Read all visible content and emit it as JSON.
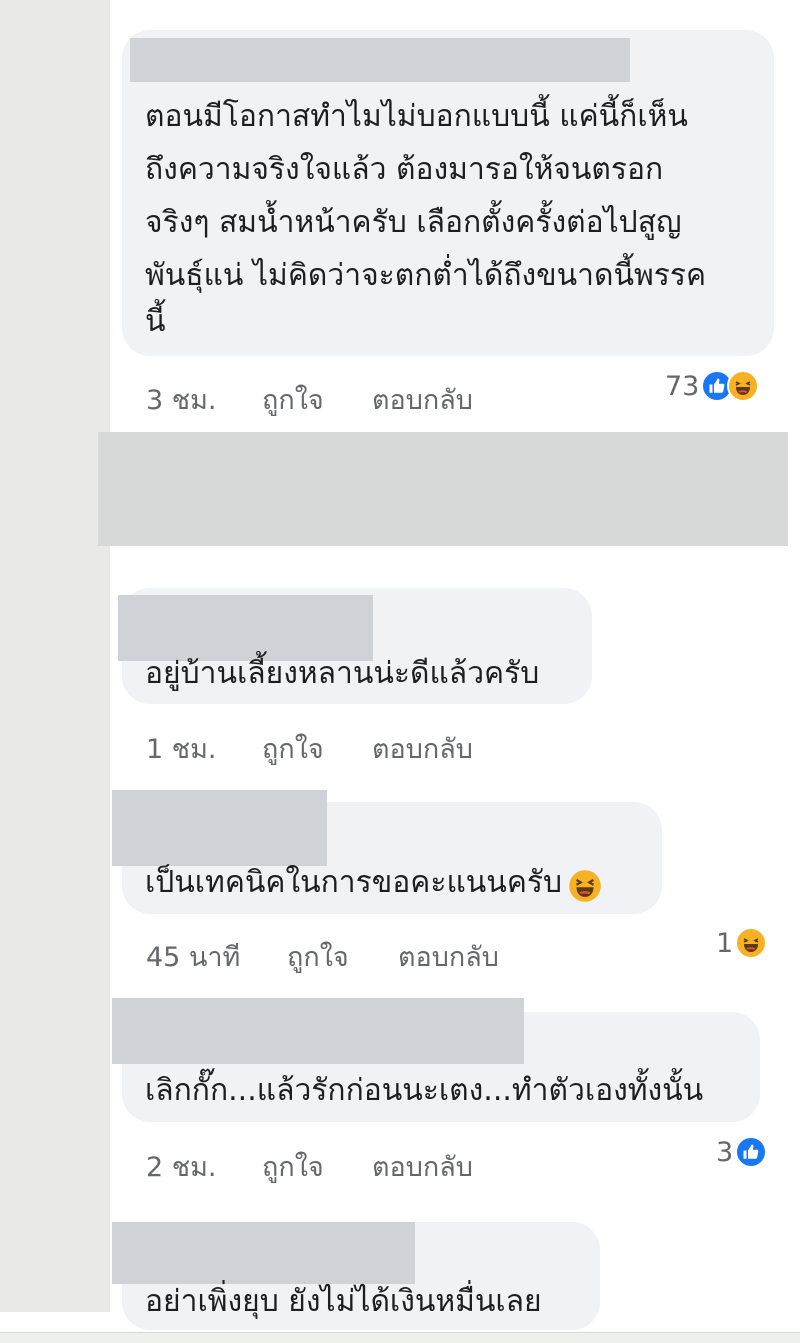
{
  "comments": [
    {
      "lines": [
        "ตอนมีโอกาสทำไมไม่บอกแบบนี้ แค่นี้ก็เห็น",
        "ถึงความจริงใจแล้ว ต้องมารอให้จนตรอก",
        "จริงๆ สมน้ำหน้าครับ เลือกตั้งครั้งต่อไปสูญ",
        "พันธุ์แน่ ไม่คิดว่าจะตกต่ำได้ถึงขนาดนี้พรรค",
        "นี้"
      ],
      "time": "3 ชม.",
      "like_label": "ถูกใจ",
      "reply_label": "ตอบกลับ",
      "reaction_count": "73",
      "reactions": [
        "like-icon",
        "haha-icon"
      ]
    },
    {
      "lines": [
        "อยู่บ้านเลี้ยงหลานน่ะดีแล้วครับ"
      ],
      "time": "1 ชม.",
      "like_label": "ถูกใจ",
      "reply_label": "ตอบกลับ"
    },
    {
      "lines": [
        "เป็นเทคนิคในการขอคะแนนครับ"
      ],
      "emoji": "laughing-emoji-icon",
      "time": "45 นาที",
      "like_label": "ถูกใจ",
      "reply_label": "ตอบกลับ",
      "reaction_count": "1",
      "reactions": [
        "haha-icon"
      ]
    },
    {
      "lines": [
        "เลิกกั๊ก...แล้วรักก่อนนะเตง...ทำตัวเองทั้งนั้น"
      ],
      "time": "2 ชม.",
      "like_label": "ถูกใจ",
      "reply_label": "ตอบกลับ",
      "reaction_count": "3",
      "reactions": [
        "like-icon"
      ]
    },
    {
      "lines": [
        "อย่าเพิ่งยุบ ยังไม่ได้เงินหมื่นเลย"
      ]
    }
  ],
  "colors": {
    "bubble": "#f0f2f5",
    "meta_text": "#65676b",
    "like_blue": "#1877f2",
    "haha_yellow": "#f7b125",
    "redaction": "#cfd2d7",
    "left_strip": "#e9eae6"
  }
}
